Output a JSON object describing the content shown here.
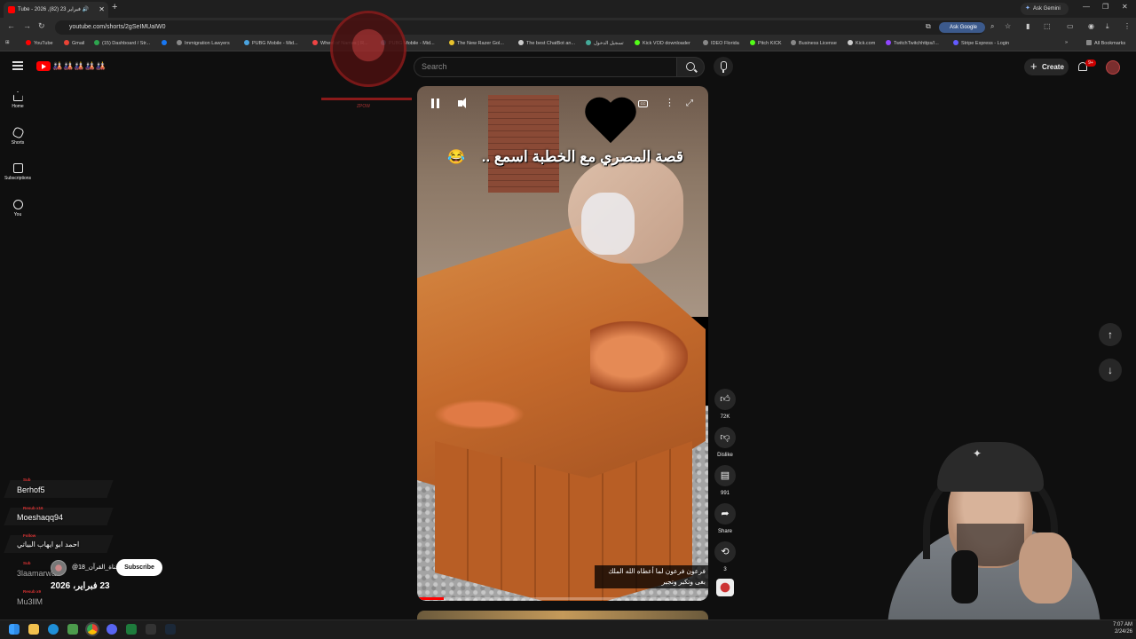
{
  "browser": {
    "tab_title": "Tube - 2026 ,فبراير 23 (82) 🔊",
    "url": "youtube.com/shorts/2gSeIMUaIW0",
    "ask_gemini": "Ask Gemini",
    "ask_google": "Ask Google",
    "bookmarks": [
      "YouTube",
      "Gmail",
      "(15) Dashboard / Str...",
      "",
      "Immigration Lawyers",
      "PUBG Mobile - Mid...",
      "Wheel of Names | R...",
      "PUBG Mobile - Mid...",
      "The New Razer Gol...",
      "The best ChatBot an...",
      "تسجيل الدخول",
      "Kick VOD downloader",
      "IDEO Florida",
      "Pitch KICK",
      "Business License",
      "Kick.com",
      "TwitchTwitchhttps//...",
      "Stripe Express - Login",
      "All Bookmarks"
    ]
  },
  "masthead": {
    "logo_text": "🎎🎎🎎🎎🎎",
    "search_placeholder": "Search",
    "create_label": "Create",
    "notif_count": "9+"
  },
  "sidebar": {
    "items": [
      {
        "label": "Home",
        "icon": "home-icon"
      },
      {
        "label": "Shorts",
        "icon": "shorts-icon"
      },
      {
        "label": "Subscriptions",
        "icon": "subscriptions-icon"
      },
      {
        "label": "You",
        "icon": "you-icon"
      }
    ]
  },
  "overlay": {
    "caption": "ZPOW"
  },
  "video": {
    "title_ar": "قصة المصري مع الخطبة اسمع ..",
    "emoji": "😂",
    "subtitle_line1": "فرعون فرعون لما أعطاه الله الملك",
    "subtitle_line2": "بغى وتكبر وتجبر",
    "progress": 0.09
  },
  "actions": {
    "like_count": "72K",
    "dislike_label": "Dislike",
    "comment_count": "991",
    "share_label": "Share",
    "remix_count": "3"
  },
  "chat": {
    "events": [
      {
        "tag": "Sub",
        "name": "Berhof5"
      },
      {
        "tag": "Resub x16",
        "name": "Moeshaqq94"
      },
      {
        "tag": "Follow",
        "name": "احمد ابو ايهاب البياتي"
      },
      {
        "tag": "Sub",
        "name": "3laamarwan"
      },
      {
        "tag": "Resub x9",
        "name": "Mu3llM"
      }
    ],
    "sub_handle": "@قناة_القرآن_18",
    "subscribe_label": "Subscribe",
    "date_text": "23 فبراير، 2026"
  },
  "taskbar": {
    "time": "7:07 AM",
    "date": "2/24/26"
  },
  "colors": {
    "accent": "#ff0000",
    "background": "#0f0f0f",
    "chip": "#272727"
  }
}
